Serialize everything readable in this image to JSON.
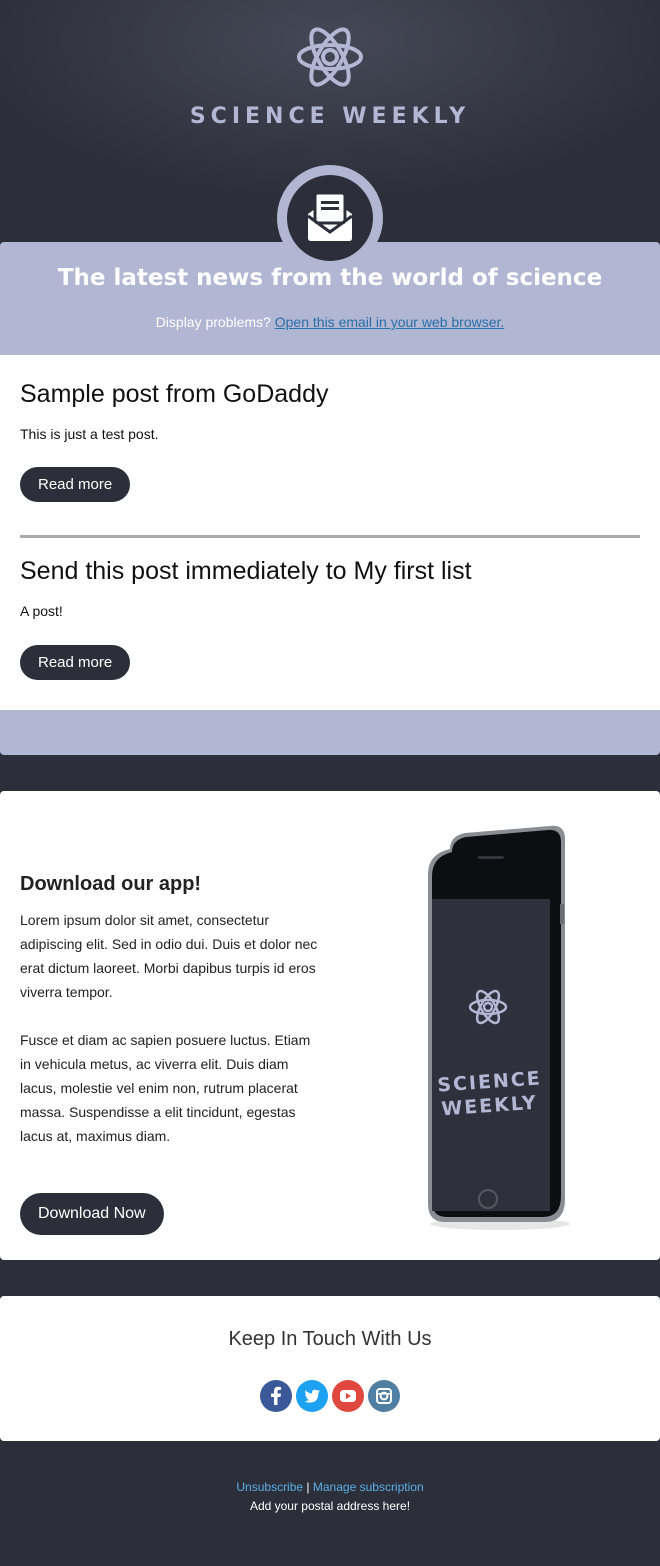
{
  "header": {
    "brand": "SCIENCE WEEKLY",
    "logo_icon": "atom-icon"
  },
  "banner": {
    "badge_icon": "open-envelope-icon",
    "title": "The latest news from the world of science",
    "display_problems": "Display problems?",
    "browser_link": "Open this email in your web browser."
  },
  "posts": [
    {
      "title": "Sample post from GoDaddy",
      "excerpt": "This is just a test post.",
      "button": "Read more"
    },
    {
      "title": "Send this post immediately to My first list",
      "excerpt": "A post!",
      "button": "Read more"
    }
  ],
  "app": {
    "title": "Download our app!",
    "paragraph1": "Lorem ipsum dolor sit amet, consectetur adipiscing elit. Sed in odio dui. Duis et dolor nec erat dictum laoreet. Morbi dapibus turpis id eros viverra tempor.",
    "paragraph2": "Fusce et diam ac sapien posuere luctus. Etiam in vehicula metus, ac viverra elit. Duis diam lacus, molestie vel enim non, rutrum placerat massa. Suspendisse a elit tincidunt, egestas lacus at, maximus diam.",
    "button": "Download Now",
    "phone_screen_text": [
      "SCIENCE",
      "WEEKLY"
    ]
  },
  "social": {
    "title": "Keep In Touch With Us",
    "icons": [
      {
        "name": "facebook-icon",
        "color": "#3b5998"
      },
      {
        "name": "twitter-icon",
        "color": "#1da1f2"
      },
      {
        "name": "youtube-icon",
        "color": "#e0483e"
      },
      {
        "name": "instagram-icon",
        "color": "#517fa4"
      }
    ]
  },
  "footer": {
    "unsubscribe": "Unsubscribe",
    "separator": "|",
    "manage": "Manage subscription",
    "address": "Add your postal address here!"
  },
  "colors": {
    "background": "#2c2f3a",
    "accent": "#b1b6d3",
    "link": "#2a6fa8"
  }
}
